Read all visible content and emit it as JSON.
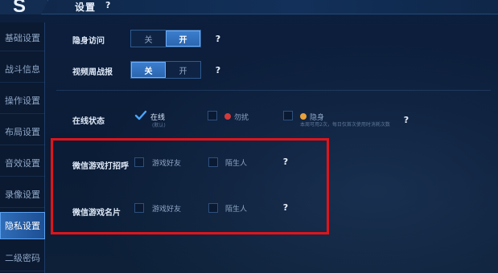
{
  "header": {
    "logo_glyph": "S",
    "title": "设置",
    "help": "?"
  },
  "sidebar": {
    "items": [
      {
        "label": "基础设置",
        "active": false
      },
      {
        "label": "战斗信息",
        "active": false
      },
      {
        "label": "操作设置",
        "active": false
      },
      {
        "label": "布局设置",
        "active": false
      },
      {
        "label": "音效设置",
        "active": false
      },
      {
        "label": "录像设置",
        "active": false
      },
      {
        "label": "隐私设置",
        "active": true
      },
      {
        "label": "二级密码",
        "active": false
      }
    ]
  },
  "settings": {
    "stealth_visit": {
      "label": "隐身访问",
      "off": "关",
      "on": "开",
      "selected": "开"
    },
    "weekly_report": {
      "label": "视频周战报",
      "off": "关",
      "on": "开",
      "selected": "关"
    },
    "online_status": {
      "label": "在线状态",
      "options": [
        {
          "label": "在线",
          "sub": "(默认)",
          "checked": true
        },
        {
          "label": "勿扰",
          "checked": false
        },
        {
          "label": "隐身",
          "sub": "本周可用2次，每日仅首次使用时消耗次数",
          "checked": false
        }
      ]
    },
    "wechat_greet": {
      "label": "微信游戏打招呼",
      "options": [
        {
          "label": "游戏好友",
          "checked": false
        },
        {
          "label": "陌生人",
          "checked": false
        }
      ]
    },
    "wechat_card": {
      "label": "微信游戏名片",
      "options": [
        {
          "label": "游戏好友",
          "checked": false
        },
        {
          "label": "陌生人",
          "checked": false
        }
      ]
    },
    "help": "?"
  },
  "colors": {
    "accent": "#2f6db8",
    "highlight_box": "#e0141b",
    "dnd_icon": "#d23a3a",
    "invisible_icon": "#e8a23a"
  }
}
